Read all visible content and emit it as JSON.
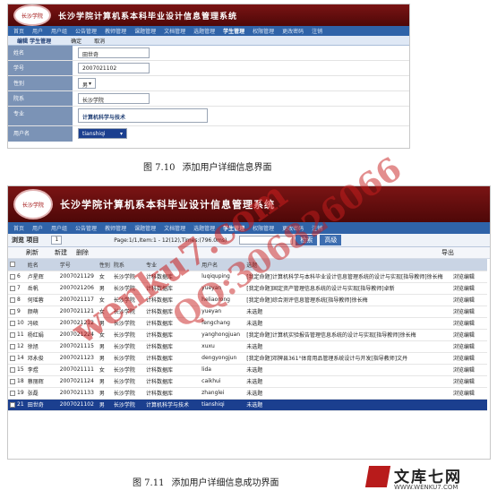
{
  "app_title": "长沙学院计算机系本科毕业设计信息管理系统",
  "logo_text": "长沙学院",
  "nav_items": [
    "首页",
    "用户",
    "用户组",
    "公告管理",
    "教师管理",
    "课题管理",
    "文档管理",
    "选题管理",
    "学生管理",
    "权限管理",
    "更改密码",
    "注销"
  ],
  "nav_active": "学生管理",
  "figure1": {
    "tab_edit": "编辑 学生管理",
    "tab_confirm": "确定",
    "tab_cancel": "取消",
    "fields": [
      {
        "label": "姓名",
        "value": "田世奇"
      },
      {
        "label": "学号",
        "value": "2007021102"
      },
      {
        "label": "性别",
        "value": "男"
      },
      {
        "label": "院系",
        "value": "长沙学院"
      },
      {
        "label": "专业",
        "value": "计算机科学与技术"
      },
      {
        "label": "用户名",
        "value": "tianshiqi"
      }
    ],
    "caption_num": "图 7.10",
    "caption": "添加用户详细信息界面"
  },
  "figure2": {
    "browse_label": "浏览 项目",
    "page_box": "1",
    "page_info": "Page:1/1,Item:1 - 12(12),Times:(796.0ms)",
    "search_btn": "检索",
    "advanced_btn": "高级",
    "refresh_btn": "刷新",
    "new_btn": "新建",
    "delete_btn": "删除",
    "export_btn": "导出",
    "columns": [
      "姓名",
      "学号",
      "性别",
      "院系",
      "专业",
      "用户名",
      "选题",
      ""
    ],
    "rows": [
      {
        "id": "6",
        "name": "卢星辉",
        "no": "2007021129",
        "sex": "女",
        "dept": "长沙学院",
        "major": "计科数据库",
        "user": "luqiquping",
        "topic": "[我定命题]计算机科学与本科毕业设计信息管理系统的设计与实现[指导教师]徐长梅",
        "op": "浏览编辑"
      },
      {
        "id": "7",
        "name": "岳帆",
        "no": "2007021206",
        "sex": "男",
        "dept": "长沙学院",
        "major": "计科数据库",
        "user": "yueyan",
        "topic": "[我定命题]固定资产管理信息系统的设计与实现[指导教师]卓新",
        "op": "浏览编辑"
      },
      {
        "id": "8",
        "name": "何瑶蓉",
        "no": "2007021117",
        "sex": "女",
        "dept": "长沙学院",
        "major": "计科数据库",
        "user": "heliaorong",
        "topic": "[我定命题]综合测评信息管理系统[指导教师]徐长梅",
        "op": "浏览编辑"
      },
      {
        "id": "9",
        "name": "颜萌",
        "no": "2007021121",
        "sex": "女",
        "dept": "长沙学院",
        "major": "计科数据库",
        "user": "yueyan",
        "topic": "未选题",
        "op": "浏览编辑"
      },
      {
        "id": "10",
        "name": "冯硕",
        "no": "2007021212",
        "sex": "男",
        "dept": "长沙学院",
        "major": "计科数据库",
        "user": "fengchang",
        "topic": "未选题",
        "op": "浏览编辑"
      },
      {
        "id": "11",
        "name": "杨红娟",
        "no": "2007021224",
        "sex": "女",
        "dept": "长沙学院",
        "major": "计科数据库",
        "user": "yanghongjuan",
        "topic": "[我定命题]计算机实验报告管理信息系统的设计与实现[指导教师]徐长梅",
        "op": "浏览编辑"
      },
      {
        "id": "12",
        "name": "徐旭",
        "no": "2007021115",
        "sex": "男",
        "dept": "长沙学院",
        "major": "计科数据库",
        "user": "xuxu",
        "topic": "未选题",
        "op": "浏览编辑"
      },
      {
        "id": "14",
        "name": "邓永俊",
        "no": "2007021123",
        "sex": "男",
        "dept": "长沙学院",
        "major": "计科数据库",
        "user": "dengyongjun",
        "topic": "[我定命题]邓牌县361°体育用品管理系统设计与开发[指导教师]文丹",
        "op": "浏览编辑"
      },
      {
        "id": "15",
        "name": "李煜",
        "no": "2007021111",
        "sex": "女",
        "dept": "长沙学院",
        "major": "计科数据库",
        "user": "lida",
        "topic": "未选题",
        "op": "浏览编辑"
      },
      {
        "id": "18",
        "name": "蔡丽辉",
        "no": "2007021124",
        "sex": "男",
        "dept": "长沙学院",
        "major": "计科数据库",
        "user": "caikhui",
        "topic": "未选题",
        "op": "浏览编辑"
      },
      {
        "id": "19",
        "name": "张磊",
        "no": "2007021133",
        "sex": "男",
        "dept": "长沙学院",
        "major": "计科数据库",
        "user": "zhanglei",
        "topic": "未选题",
        "op": "浏览编辑"
      },
      {
        "id": "21",
        "name": "田世奇",
        "no": "2007021102",
        "sex": "男",
        "dept": "长沙学院",
        "major": "计算机科学与技术",
        "user": "tianshiqi",
        "topic": "未选题",
        "op": ""
      }
    ],
    "caption_num": "图 7.11",
    "caption": "添加用户详细信息成功界面"
  },
  "watermark_1": "wenku7.com",
  "watermark_2": "QQ:306826066",
  "footer_logo": "文库七网",
  "footer_url": "WWW.WENKU7.COM",
  "colors": {
    "banner": "#6b1010",
    "nav": "#2f63a8",
    "highlight_row": "#1b3f8f",
    "watermark": "#c81e1e"
  }
}
